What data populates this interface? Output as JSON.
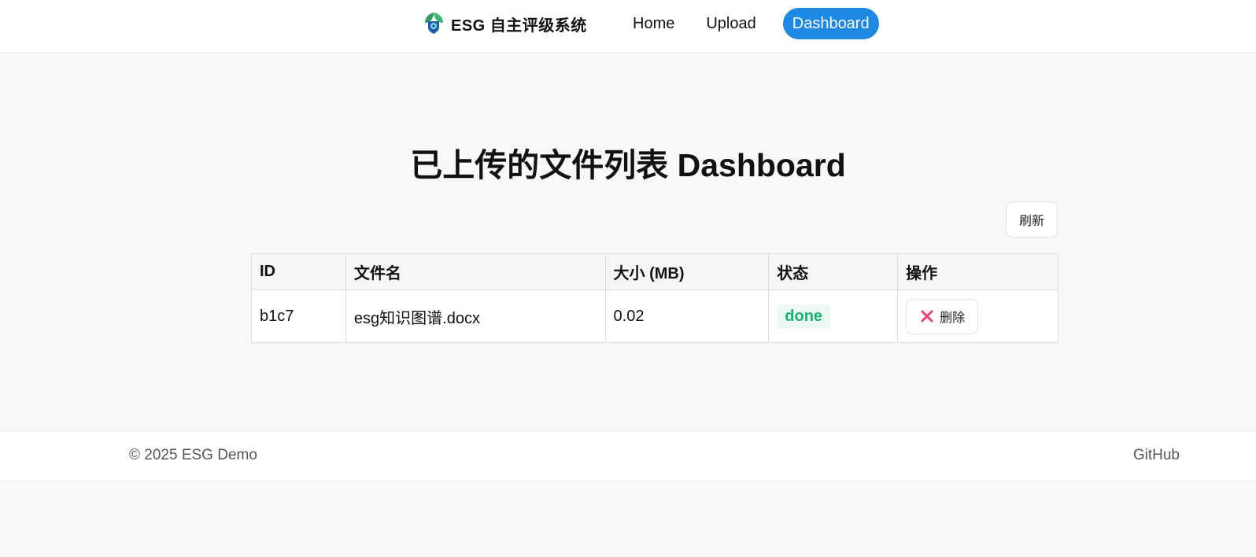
{
  "brand": {
    "title": "ESG 自主评级系统",
    "logo_icon": "leaf-shield-logo-icon"
  },
  "nav": {
    "items": [
      {
        "label": "Home"
      },
      {
        "label": "Upload"
      },
      {
        "label": "Dashboard"
      }
    ],
    "active": "Dashboard",
    "accent_color": "#1e88e5"
  },
  "main": {
    "title": "已上传的文件列表 Dashboard",
    "refresh_label": "刷新"
  },
  "table": {
    "headers": [
      "ID",
      "文件名",
      "大小 (MB)",
      "状态",
      "操作"
    ],
    "rows": [
      {
        "id": "b1c7",
        "filename": "esg知识图谱.docx",
        "size": "0.02",
        "status": "done",
        "action_label": "删除"
      }
    ],
    "status_color": "#16b470",
    "delete_icon": "x-icon",
    "delete_icon_color": "#e8436a"
  },
  "footer": {
    "copyright": "© 2025 ESG Demo",
    "github_label": "GitHub"
  }
}
